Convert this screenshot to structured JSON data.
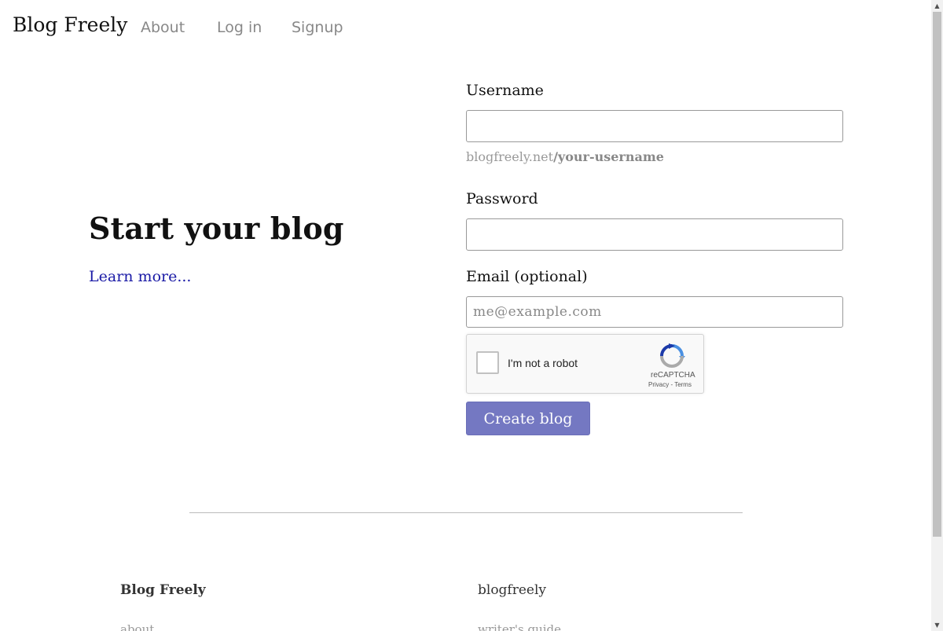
{
  "header": {
    "brand": "Blog Freely",
    "nav": {
      "about": "About",
      "login": "Log in",
      "signup": "Signup"
    }
  },
  "hero": {
    "title": "Start your blog",
    "learn_more": "Learn more..."
  },
  "form": {
    "username_label": "Username",
    "username_value": "",
    "url_prefix": "blogfreely.net",
    "url_suffix": "/your-username",
    "password_label": "Password",
    "password_value": "",
    "email_label": "Email (optional)",
    "email_placeholder": "me@example.com",
    "email_value": "",
    "submit_label": "Create blog"
  },
  "captcha": {
    "label": "I'm not a robot",
    "brand": "reCAPTCHA",
    "links": "Privacy - Terms",
    "checked": false
  },
  "footer": {
    "brand": "Blog Freely",
    "handle": "blogfreely",
    "about_link": "about",
    "guide_link": "writer's guide"
  },
  "colors": {
    "accent_button": "#7478c2",
    "link": "#1a1aa6",
    "muted_text": "#999999"
  },
  "icons": {
    "captcha_logo": "recaptcha-icon",
    "scroll_up": "scroll-up-arrow-icon",
    "scroll_down": "scroll-down-arrow-icon"
  }
}
